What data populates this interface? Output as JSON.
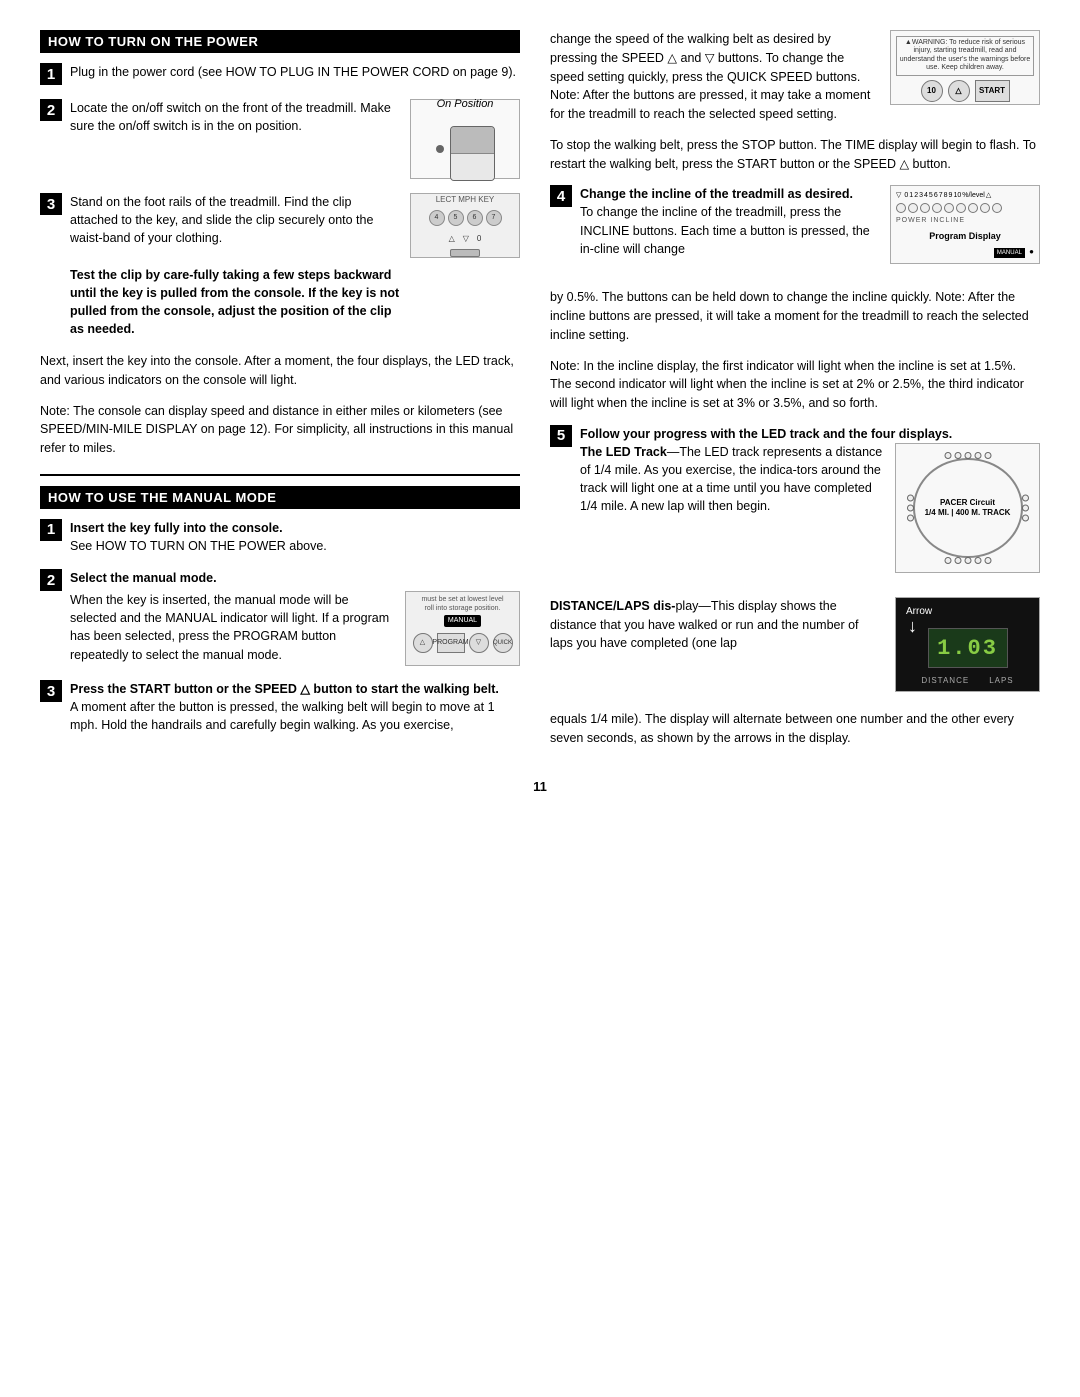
{
  "page": {
    "number": "11"
  },
  "left_column": {
    "section1_header": "HOW TO TURN ON THE POWER",
    "step1": {
      "number": "1",
      "text": "Plug in the power cord (see HOW TO PLUG IN THE POWER CORD on page 9)."
    },
    "step2": {
      "number": "2",
      "text": "Locate the on/off switch on the front of the treadmill. Make sure the on/off switch is in the on position.",
      "illustration_label": "On Position"
    },
    "step3": {
      "number": "3",
      "text_pre": "Stand on the foot rails of the treadmill. Find the clip attached to the key, and slide the clip securely onto the waist-band of your clothing.",
      "bold_text": "Test the clip by care-fully taking a few steps backward until the key is pulled from the console. If the key is not pulled from the console, adjust the position of the clip as needed."
    },
    "para1": "Next, insert the key into the console. After a moment, the four displays, the LED track, and various indicators on the console will light.",
    "para2": "Note: The console can display speed and distance in either miles or kilometers (see SPEED/MIN-MILE DISPLAY on page 12). For simplicity, all instructions in this manual refer to miles.",
    "section2_header": "HOW TO USE THE MANUAL MODE",
    "step_m1": {
      "number": "1",
      "bold_text": "Insert the key fully into the console.",
      "text": "See HOW TO TURN ON THE POWER above."
    },
    "step_m2": {
      "number": "2",
      "bold_text": "Select the manual mode.",
      "text": "When the key is inserted, the manual mode will be selected and the MANUAL indicator will light. If a program has been selected, press the PROGRAM button repeatedly to select the manual mode.",
      "console_labels": {
        "top": "must be set at lowest level",
        "manual": "MANUAL",
        "roll": "roll into storage position."
      }
    },
    "step_m3": {
      "number": "3",
      "bold_text": "Press the START button or the SPEED △ button to start the walking belt.",
      "text": "A moment after the button is pressed, the walking belt will begin to move at 1 mph. Hold the handrails and carefully begin walking. As you exercise,"
    }
  },
  "right_column": {
    "para_speed": "change the speed of the walking belt as desired by pressing the SPEED △ and ▽ buttons. To change the speed setting quickly, press the QUICK SPEED buttons. Note: After the buttons are pressed, it may take a moment for the treadmill to reach the selected speed setting.",
    "speed_panel": {
      "warning": "▲WARNING: To reduce risk of serious injury, starting treadmill, read and understand the user's the warnings before use. Keep children away.",
      "btn_10": "10",
      "btn_up": "△",
      "btn_start": "START"
    },
    "para_stop": "To stop the walking belt, press the STOP button. The TIME display will begin to flash. To restart the walking belt, press the START button or the SPEED △ button.",
    "step4": {
      "number": "4",
      "bold_text": "Change the incline of the treadmill as desired.",
      "text": "To change the incline of the treadmill, press the INCLINE buttons. Each time a button is pressed, the in-cline will change",
      "program_display_label": "Program Display",
      "manual_label": "MANUAL"
    },
    "para_incline1": "by 0.5%. The buttons can be held down to change the incline quickly. Note: After the incline buttons are pressed, it will take a moment for the treadmill to reach the selected incline setting.",
    "para_incline2": "Note: In the incline display, the first indicator will light when the incline is set at 1.5%. The second indicator will light when the incline is set at 2% or 2.5%, the third indicator will light when the incline is set at 3% or 3.5%, and so forth.",
    "step5": {
      "number": "5",
      "bold_text": "Follow your progress with the LED track and the four displays.",
      "led_track_title": "The LED Track",
      "led_track_text": "The LED track represents a distance of 1/4 mile. As you exercise, the indica-tors around the track will light one at a time until you have completed 1/4 mile. A new lap will then begin.",
      "pacer_label": "PACER Circuit",
      "pacer_sub": "1/4 MI. | 400 M. TRACK"
    },
    "distance_section": {
      "title": "DISTANCE/LAPS dis-",
      "text": "play—This display shows the distance that you have walked or run and the number of laps you have completed (one lap",
      "arrow_label": "Arrow",
      "lcd_value": "1.03",
      "dist_label": "DISTANCE",
      "laps_label": "LAPS"
    },
    "para_distance": "equals 1/4 mile). The display will alternate between one number and the other every seven seconds, as shown by the arrows in the display."
  }
}
